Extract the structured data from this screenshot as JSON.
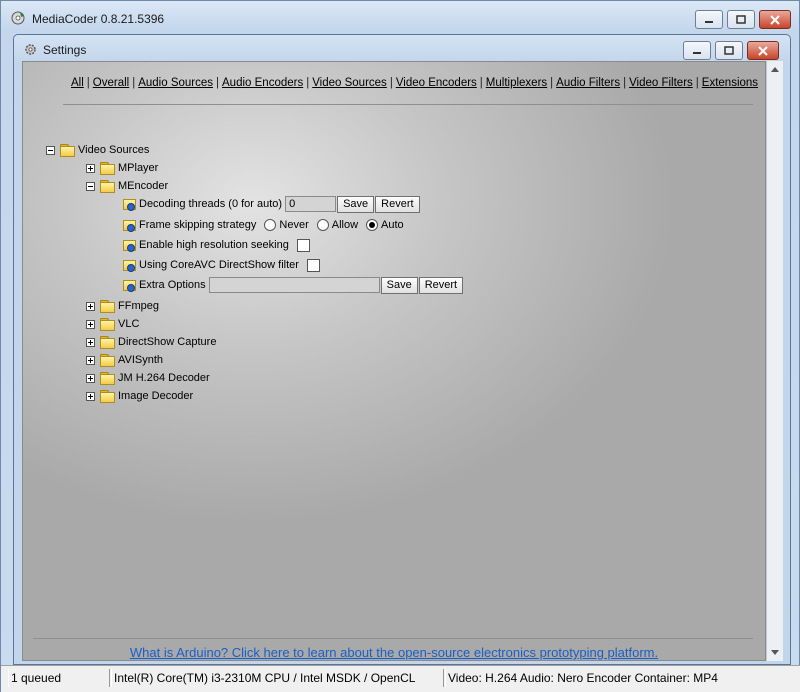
{
  "app": {
    "title": "MediaCoder 0.8.21.5396"
  },
  "dialog": {
    "title": "Settings"
  },
  "nav": [
    "All",
    "Overall",
    "Audio Sources",
    "Audio Encoders",
    "Video Sources",
    "Video Encoders",
    "Multiplexers",
    "Audio Filters",
    "Video Filters",
    "Extensions"
  ],
  "tree": {
    "root": "Video Sources",
    "mplayer": "MPlayer",
    "mencoder": "MEncoder",
    "decoding_threads": {
      "label": "Decoding threads (0 for auto)",
      "value": "0",
      "save": "Save",
      "revert": "Revert"
    },
    "frame_skipping": {
      "label": "Frame skipping strategy",
      "options": [
        "Never",
        "Allow",
        "Auto"
      ],
      "selected": "Auto"
    },
    "high_res_seeking": {
      "label": "Enable high resolution seeking",
      "checked": false
    },
    "coreavc": {
      "label": "Using CoreAVC DirectShow filter",
      "checked": false
    },
    "extra_options": {
      "label": "Extra Options",
      "value": "",
      "save": "Save",
      "revert": "Revert"
    },
    "ffmpeg": "FFmpeg",
    "vlc": "VLC",
    "directshow": "DirectShow Capture",
    "avisynth": "AVISynth",
    "jm": "JM H.264 Decoder",
    "image_decoder": "Image Decoder"
  },
  "promo": {
    "text": "What is Arduino? Click here to learn about the open-source electronics prototyping platform."
  },
  "status": {
    "queued": "1 queued",
    "cpu": "Intel(R) Core(TM) i3-2310M CPU  / Intel MSDK / OpenCL",
    "format": "Video: H.264  Audio: Nero Encoder  Container: MP4"
  }
}
